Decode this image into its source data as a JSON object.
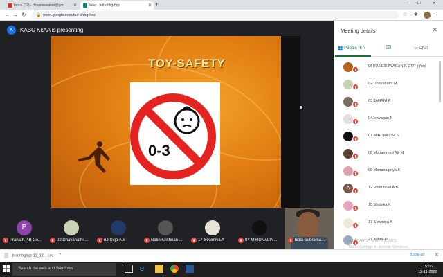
{
  "browser": {
    "tabs": [
      {
        "title": "Inbox (32) - dhyaneswaran@gm...",
        "favicon_color": "#d93025"
      },
      {
        "title": "Meet - buf-ohhg-bqz",
        "favicon_color": "#00897b"
      }
    ],
    "new_tab": "+",
    "url": "meet.google.com/buf-ohhg-bqz",
    "window_controls": [
      "—",
      "□",
      "✕"
    ]
  },
  "meet": {
    "presenter_initial": "K",
    "presenter_label": "KASC KkAA is presenting",
    "slide": {
      "title": "TOY-SAFETY",
      "age_label": "0-3"
    },
    "filmstrip": [
      {
        "initial": "P",
        "name": "Pranath.P.B Co...",
        "color": "#8e44ad"
      },
      {
        "initial": "",
        "name": "02 Dhayanathi ...",
        "color": "#c9d3b5"
      },
      {
        "initial": "",
        "name": "62 Suja A.k",
        "color": "#223a6b"
      },
      {
        "initial": "",
        "name": "Nalin Krishnan ...",
        "color": "#444"
      },
      {
        "initial": "",
        "name": "17 Sowmiya A",
        "color": "#e8e3d5"
      },
      {
        "initial": "",
        "name": "07 MIRUNALIN...",
        "color": "#111"
      }
    ],
    "video_tile_name": "Bala Subrama..."
  },
  "panel": {
    "title": "Meeting details",
    "close": "✕",
    "tabs": {
      "people": "People (67)",
      "chat": "Chat"
    },
    "participants": [
      {
        "name": "DHYANESHWARAN K CT/T (You)",
        "color": "#b5651d"
      },
      {
        "name": "02 Dhayanathi M",
        "color": "#c9d3b5"
      },
      {
        "name": "03 JANANI R",
        "color": "#7a6a5a"
      },
      {
        "name": "04Jeevagan N",
        "color": "#e0e0e0"
      },
      {
        "name": "07 MIRUNALINI S",
        "color": "#111111"
      },
      {
        "name": "08 Mohammed Ajil M",
        "color": "#5a4030"
      },
      {
        "name": "09 Mohana priya K",
        "color": "#d9a0b0"
      },
      {
        "name": "12 Phanthivel A B",
        "color": "#795548"
      },
      {
        "name": "15 Shobika K",
        "color": "#e6a6c0"
      },
      {
        "name": "17 Sowmiya A",
        "color": "#efe8d8"
      },
      {
        "name": "21 Ashok P",
        "color": "#9ab"
      }
    ],
    "watermark": "Activate Windows",
    "watermark_sub": "Go to Settings to activate Windows."
  },
  "downloads": {
    "file": "bufohhgbqz 11_12....csv",
    "show_all": "Show all",
    "close": "✕"
  },
  "taskbar": {
    "search_placeholder": "Search the web and Windows",
    "time": "15:05",
    "date": "12-11-2020"
  }
}
